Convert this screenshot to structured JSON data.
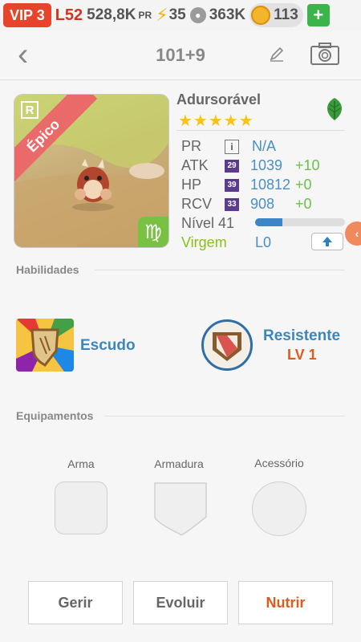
{
  "topbar": {
    "vip": "VIP 3",
    "level": "L52",
    "power": "528,8K",
    "power_unit": "PR",
    "energy": "35",
    "food": "363K",
    "coins": "113",
    "plus": "+"
  },
  "header": {
    "title": "101+9"
  },
  "monster": {
    "rarity": "Épico",
    "rank_letter": "R",
    "name": "Adursorável",
    "stars": "★★★★★",
    "zodiac_symbol": "♍",
    "level_progress": 0.3,
    "stats": {
      "pr_label": "PR",
      "pr_value": "N/A",
      "atk_label": "ATK",
      "atk_badge": "29",
      "atk_value": "1039",
      "atk_bonus": "+10",
      "hp_label": "HP",
      "hp_badge": "39",
      "hp_value": "10812",
      "hp_bonus": "+0",
      "rcv_label": "RCV",
      "rcv_badge": "33",
      "rcv_value": "908",
      "rcv_bonus": "+0",
      "level_label": "Nível 41",
      "sign_label": "Virgem",
      "sign_value": "L0"
    }
  },
  "skills": {
    "section_label": "Habilidades",
    "skill1": "Escudo",
    "skill2": "Resistente",
    "skill2_level": "LV 1"
  },
  "equipment": {
    "section_label": "Equipamentos",
    "weapon": "Arma",
    "armor": "Armadura",
    "accessory": "Acessório"
  },
  "buttons": {
    "manage": "Gerir",
    "evolve": "Evoluir",
    "feed": "Nutrir"
  },
  "colors": {
    "accent_blue": "#3b86bf",
    "accent_orange": "#e05a1e",
    "vip_red": "#e8432b",
    "bonus_green": "#6bbf4a"
  }
}
